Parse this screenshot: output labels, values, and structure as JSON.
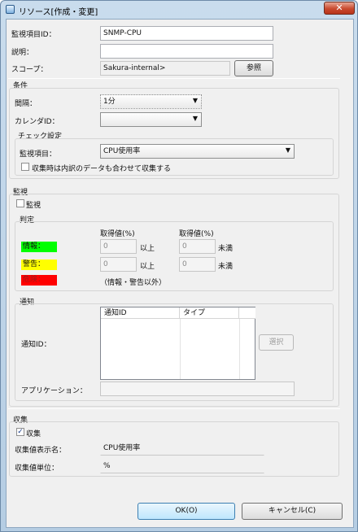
{
  "window": {
    "title": "リソース[作成・変更]",
    "close_symbol": "✕"
  },
  "basic": {
    "monitor_id_label": "監視項目ID：",
    "monitor_id_value": "SNMP-CPU",
    "description_label": "説明：",
    "description_value": "",
    "scope_label": "スコープ：",
    "scope_value": "Sakura-internal>",
    "browse_button": "参照"
  },
  "conditions": {
    "title": "条件",
    "interval_label": "間隔：",
    "interval_value": "1分",
    "calendar_label": "カレンダID：",
    "calendar_value": "",
    "check": {
      "title": "チェック設定",
      "item_label": "監視項目：",
      "item_value": "CPU使用率",
      "breakdown_label": "収集時は内訳のデータも合わせて収集する",
      "breakdown_checked": false
    }
  },
  "monitor": {
    "title": "監視",
    "enable_label": "監視",
    "enable_checked": false,
    "judgement": {
      "title": "判定",
      "col1_header": "取得値(%)",
      "col2_header": "取得値(%)",
      "rows": [
        {
          "label": "情報：",
          "color": "#00ff00",
          "min": "0",
          "min_suffix": "以上",
          "max": "0",
          "max_suffix": "未満"
        },
        {
          "label": "警告：",
          "color": "#ffff00",
          "min": "0",
          "min_suffix": "以上",
          "max": "0",
          "max_suffix": "未満"
        },
        {
          "label": "危険：",
          "color": "#ff0000",
          "note": "（情報・警告以外）"
        }
      ]
    },
    "notification": {
      "title": "通知",
      "id_label": "通知ID：",
      "table_headers": [
        "通知ID",
        "タイプ"
      ],
      "select_button": "選択",
      "app_label": "アプリケーション：",
      "app_value": ""
    }
  },
  "collection": {
    "title": "収集",
    "enable_label": "収集",
    "enable_checked": true,
    "check_mark": "✓",
    "display_name_label": "収集値表示名：",
    "display_name_value": "CPU使用率",
    "unit_label": "収集値単位：",
    "unit_value": "%"
  },
  "footer": {
    "ok_button": "OK(O)",
    "cancel_button": "キャンセル(C)"
  }
}
